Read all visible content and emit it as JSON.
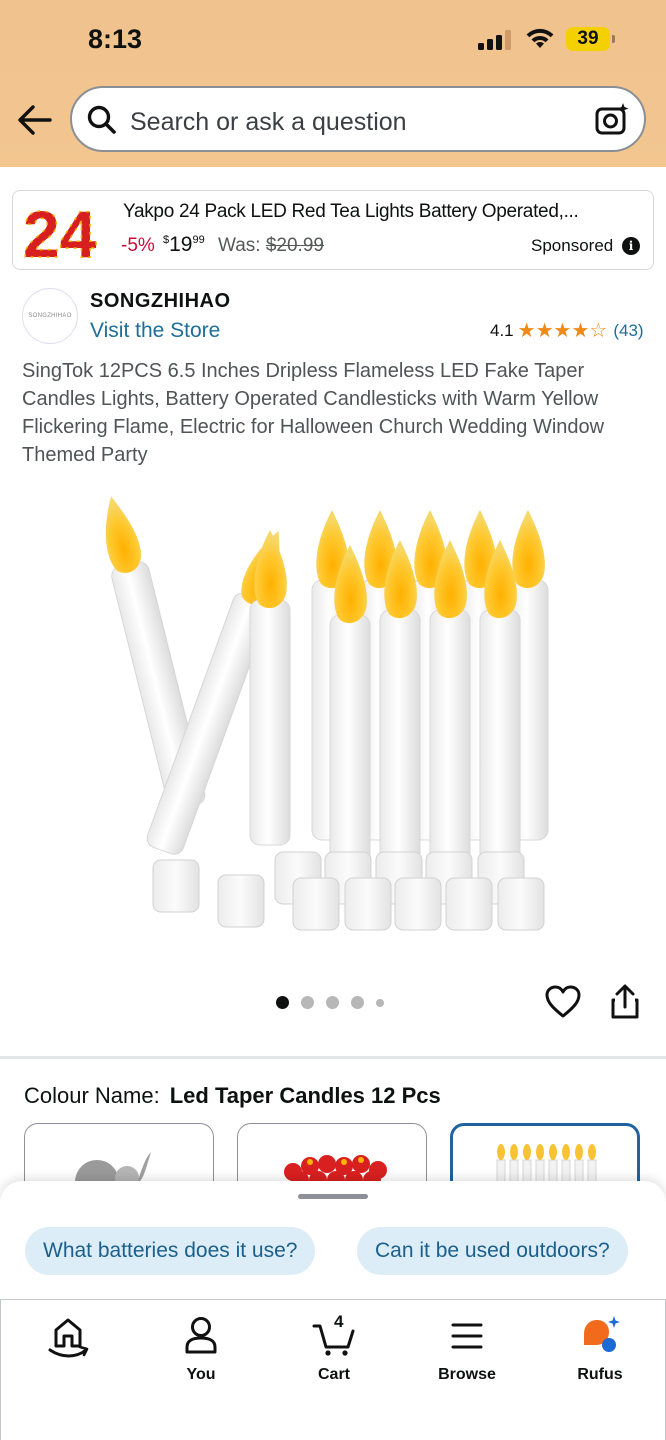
{
  "status_bar": {
    "time": "8:13",
    "battery": "39"
  },
  "search": {
    "placeholder": "Search or ask a question"
  },
  "sponsored": {
    "title": "Yakpo 24 Pack LED Red Tea Lights Battery Operated,...",
    "discount": "-5%",
    "price_symbol": "$",
    "price_whole": "19",
    "price_fraction": "99",
    "was_label": "Was:",
    "was_price": "$20.99",
    "label": "Sponsored",
    "thumb_text": "24"
  },
  "store": {
    "logo_text": "SONGZHIHAO",
    "name": "SONGZHIHAO",
    "link": "Visit the Store",
    "rating": "4.1",
    "rating_stars": 4.1,
    "rating_count": "(43)"
  },
  "product": {
    "title": "SingTok 12PCS 6.5 Inches Dripless Flameless LED Fake Taper Candles Lights, Battery Operated Candlesticks with Warm Yellow Flickering Flame, Electric for Halloween Church Wedding Window Themed Party",
    "image_count": 5,
    "active_image": 1
  },
  "variation": {
    "label": "Colour Name:",
    "value": "Led Taper Candles 12 Pcs"
  },
  "rufus_chips": [
    "What batteries does it use?",
    "Can it be used outdoors?"
  ],
  "nav": {
    "home_label": "",
    "you_label": "You",
    "cart_label": "Cart",
    "cart_count": "4",
    "browse_label": "Browse",
    "rufus_label": "Rufus"
  },
  "colors": {
    "header_bg": "#f0c28e",
    "link": "#1d6e9a",
    "star": "#f08a16",
    "discount": "#cc0c39",
    "chip_bg": "#dcedf7",
    "selected_swatch": "#2162a1"
  }
}
